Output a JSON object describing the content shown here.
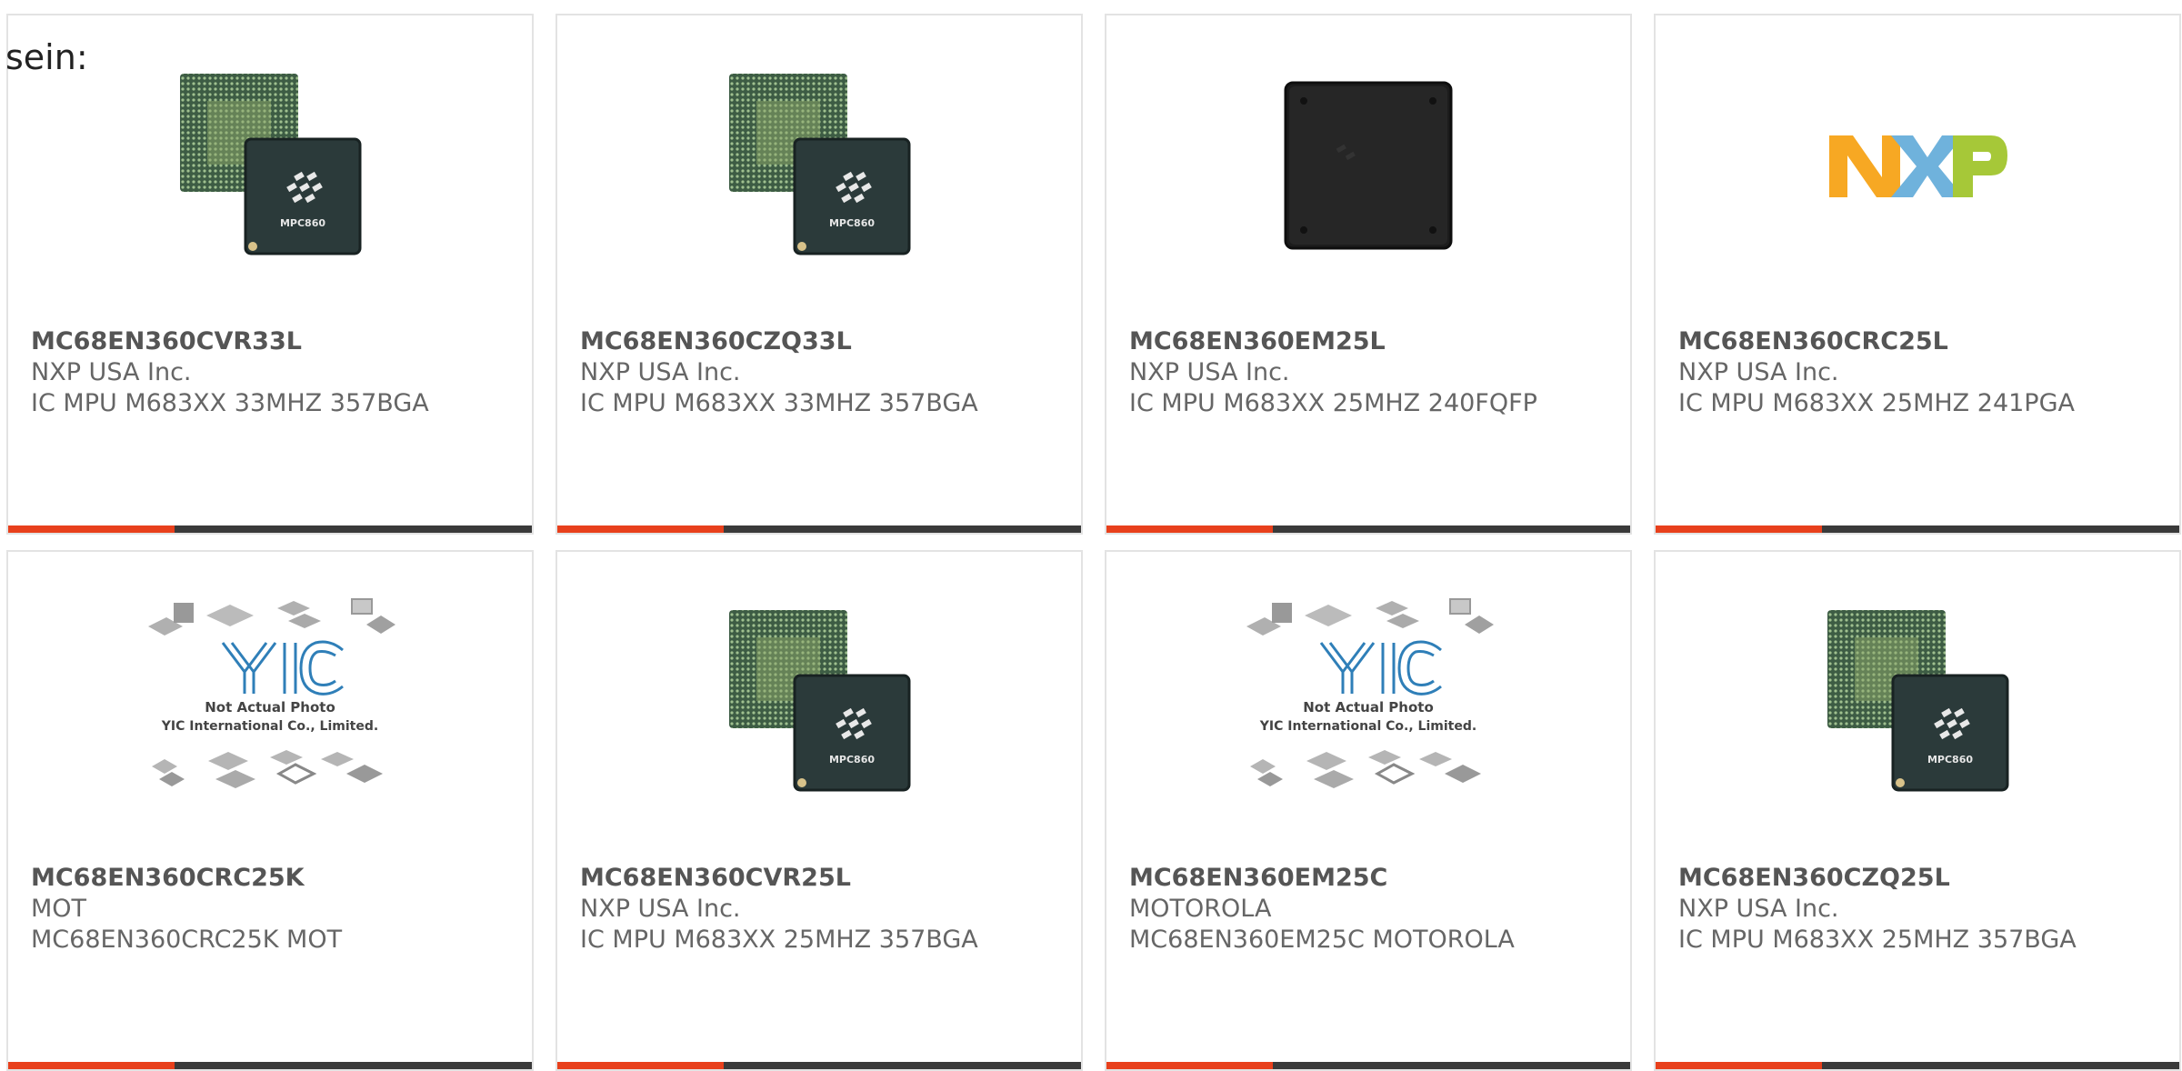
{
  "intro_text": "sein:",
  "colors": {
    "accent": "#e8401c",
    "bar_dark": "#3a3a3a",
    "card_border": "#e3e3e3",
    "text": "#666666"
  },
  "cards": [
    {
      "part": "MC68EN360CVR33L",
      "manufacturer": "NXP USA Inc.",
      "description": "IC MPU M683XX 33MHZ 357BGA",
      "image": "bga-chip-icon",
      "chip_label": "MPC860"
    },
    {
      "part": "MC68EN360CZQ33L",
      "manufacturer": "NXP USA Inc.",
      "description": "IC MPU M683XX 33MHZ 357BGA",
      "image": "bga-chip-icon",
      "chip_label": "MPC860"
    },
    {
      "part": "MC68EN360EM25L",
      "manufacturer": "NXP USA Inc.",
      "description": "IC MPU M683XX 25MHZ 240FQFP",
      "image": "qfp-chip-icon"
    },
    {
      "part": "MC68EN360CRC25L",
      "manufacturer": "NXP USA Inc.",
      "description": "IC MPU M683XX 25MHZ 241PGA",
      "image": "nxp-logo",
      "logo_text": "NXP"
    },
    {
      "part": "MC68EN360CRC25K",
      "manufacturer": "MOT",
      "description": "MC68EN360CRC25K MOT",
      "image": "placeholder-photo",
      "placeholder_logo": "YIC",
      "placeholder_line1": "Not Actual Photo",
      "placeholder_line2": "YIC International Co., Limited."
    },
    {
      "part": "MC68EN360CVR25L",
      "manufacturer": "NXP USA Inc.",
      "description": "IC MPU M683XX 25MHZ 357BGA",
      "image": "bga-chip-icon",
      "chip_label": "MPC860"
    },
    {
      "part": "MC68EN360EM25C",
      "manufacturer": "MOTOROLA",
      "description": "MC68EN360EM25C MOTOROLA",
      "image": "placeholder-photo",
      "placeholder_logo": "YIC",
      "placeholder_line1": "Not Actual Photo",
      "placeholder_line2": "YIC International Co., Limited."
    },
    {
      "part": "MC68EN360CZQ25L",
      "manufacturer": "NXP USA Inc.",
      "description": "IC MPU M683XX 25MHZ 357BGA",
      "image": "bga-chip-icon",
      "chip_label": "MPC860"
    }
  ]
}
